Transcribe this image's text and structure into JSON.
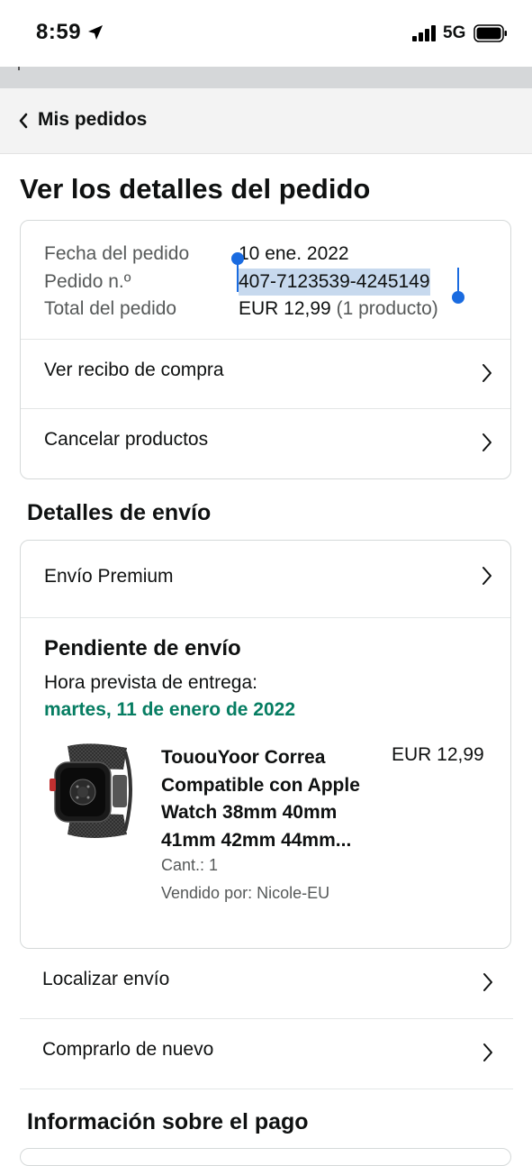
{
  "status_bar": {
    "time": "8:59",
    "network": "5G"
  },
  "nav": {
    "back_label": "Mis pedidos"
  },
  "page": {
    "title": "Ver los detalles del pedido"
  },
  "order_summary": {
    "date_label": "Fecha del pedido",
    "date_value": "10 ene. 2022",
    "number_label": "Pedido n.º",
    "number_value": "407-7123539-4245149",
    "total_label": "Total del pedido",
    "total_value": "EUR 12,99",
    "total_count": "(1 producto)"
  },
  "order_actions": [
    {
      "label": "Ver recibo de compra"
    },
    {
      "label": "Cancelar productos"
    }
  ],
  "shipping": {
    "section_title": "Detalles de envío",
    "method": "Envío Premium",
    "status": "Pendiente de envío",
    "eta_label": "Hora prevista de entrega:",
    "eta_date": "martes, 11 de enero de 2022",
    "product": {
      "name": "TououYoor Correa Compatible con Apple Watch 38mm 40mm 41mm 42mm 44mm...",
      "price": "EUR 12,99",
      "quantity": "Cant.: 1",
      "seller": "Vendido por: Nicole-EU"
    }
  },
  "shipment_actions": [
    {
      "label": "Localizar envío"
    },
    {
      "label": "Comprarlo de nuevo"
    }
  ],
  "payment": {
    "section_title": "Información sobre el pago"
  },
  "colors": {
    "eta_green": "#067d62",
    "selection_blue": "#1a6be0",
    "selection_bg": "#c7d9ee",
    "nav_bg": "#f3f3f3"
  }
}
